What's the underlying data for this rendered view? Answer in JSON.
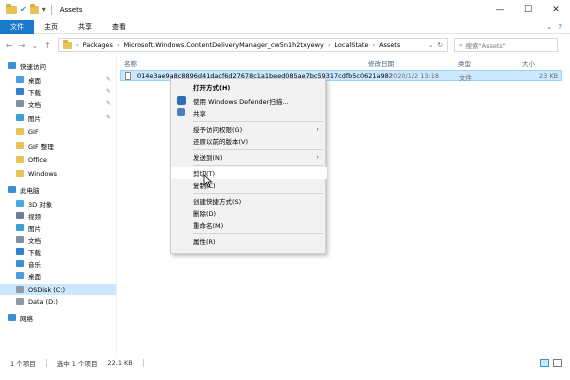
{
  "window": {
    "title": "Assets",
    "controls": [
      "—",
      "☐",
      "✕"
    ]
  },
  "ribbon": {
    "tabs": [
      "文件",
      "主页",
      "共享",
      "查看"
    ]
  },
  "address": {
    "segments": [
      "Packages",
      "Microsoft.Windows.ContentDeliveryManager_cw5n1h2txyewy",
      "LocalState",
      "Assets"
    ],
    "search_placeholder": "搜索\"Assets\""
  },
  "sidebar": {
    "items": [
      {
        "label": "快速访问",
        "icon": "star-icon",
        "color": "#3a8fd6"
      },
      {
        "label": "桌面",
        "icon": "desktop-icon",
        "color": "#4a9fe0",
        "pinned": true
      },
      {
        "label": "下载",
        "icon": "download-icon",
        "color": "#2f7fd2",
        "pinned": true
      },
      {
        "label": "文档",
        "icon": "documents-icon",
        "color": "#7f8fa6",
        "pinned": true
      },
      {
        "label": "图片",
        "icon": "pictures-icon",
        "color": "#3aa0d8",
        "pinned": true
      },
      {
        "label": "GIF",
        "icon": "folder-icon",
        "color": "#e8c457"
      },
      {
        "label": "GIF 整理",
        "icon": "folder-icon",
        "color": "#e8c457"
      },
      {
        "label": "Office",
        "icon": "folder-icon",
        "color": "#e8c457"
      },
      {
        "label": "Windows",
        "icon": "folder-icon",
        "color": "#e8c457"
      },
      {
        "label": "此电脑",
        "icon": "computer-icon",
        "color": "#3a8fd6"
      },
      {
        "label": "3D 对象",
        "icon": "3d-objects-icon",
        "color": "#4aa7e8"
      },
      {
        "label": "视频",
        "icon": "videos-icon",
        "color": "#6b7e96"
      },
      {
        "label": "图片",
        "icon": "pictures-icon",
        "color": "#3aa0d8"
      },
      {
        "label": "文档",
        "icon": "documents-icon",
        "color": "#7f8fa6"
      },
      {
        "label": "下载",
        "icon": "download-icon",
        "color": "#2f7fd2"
      },
      {
        "label": "音乐",
        "icon": "music-icon",
        "color": "#3a8fd6"
      },
      {
        "label": "桌面",
        "icon": "desktop-icon",
        "color": "#4a9fe0"
      },
      {
        "label": "OSDisk (C:)",
        "icon": "drive-icon",
        "color": "#8e9aa8",
        "selected": true
      },
      {
        "label": "Data (D:)",
        "icon": "drive-icon",
        "color": "#8e9aa8"
      },
      {
        "label": "网络",
        "icon": "network-icon",
        "color": "#3a8fd6"
      }
    ]
  },
  "columns": {
    "name": "名称",
    "date": "修改日期",
    "type": "类型",
    "size": "大小"
  },
  "file": {
    "name": "014e3ae9a8c8896d41dacf6d27678c1a1beed085ae7bc59317cdfb5c0621a982",
    "date": "2020/1/2 13:18",
    "type": "文件",
    "size": "23 KB"
  },
  "context_menu": {
    "items": [
      {
        "label": "打开方式(H)",
        "bold": true
      },
      {
        "label": "使用 Windows Defender扫描...",
        "icon": "defender-icon"
      },
      {
        "label": "共享",
        "icon": "share-icon"
      },
      {
        "label": "授予访问权限(G)",
        "submenu": true
      },
      {
        "label": "还原以前的版本(V)"
      },
      {
        "label": "发送到(N)",
        "submenu": true
      },
      {
        "label": "剪切(T)",
        "hover": true
      },
      {
        "label": "复制(C)"
      },
      {
        "label": "创建快捷方式(S)"
      },
      {
        "label": "删除(D)"
      },
      {
        "label": "重命名(M)"
      },
      {
        "label": "属性(R)"
      }
    ]
  },
  "status": {
    "count": "1 个项目",
    "selected": "选中 1 个项目",
    "size": "22.1 KB"
  }
}
